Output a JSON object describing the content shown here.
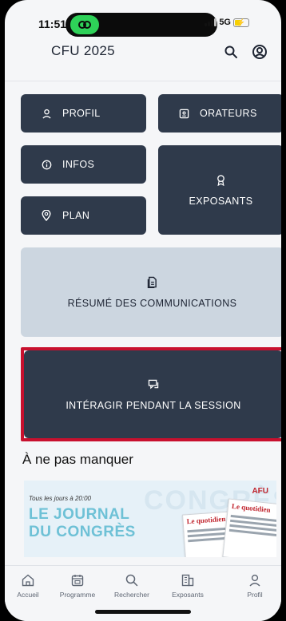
{
  "status_bar": {
    "time": "11:51",
    "network": "5G",
    "battery_level": 0.5
  },
  "header": {
    "title": "CFU 2025",
    "search_icon": "search-icon",
    "profile_icon": "user-circle-icon"
  },
  "tiles": {
    "profil": {
      "label": "PROFIL",
      "icon": "user-icon"
    },
    "orateurs": {
      "label": "ORATEURS",
      "icon": "id-card-icon"
    },
    "infos": {
      "label": "INFOS",
      "icon": "info-icon"
    },
    "exposants": {
      "label": "EXPOSANTS",
      "icon": "badge-icon"
    },
    "plan": {
      "label": "PLAN",
      "icon": "map-pin-icon"
    },
    "resume": {
      "label": "RÉSUMÉ DES COMMUNICATIONS",
      "icon": "document-icon"
    },
    "interagir": {
      "label": "INTÉRAGIR PENDANT LA SESSION",
      "icon": "chat-icon"
    }
  },
  "section": {
    "title": "À ne pas manquer"
  },
  "banner": {
    "subtitle": "Tous les jours à 20:00",
    "title_line1": "LE JOURNAL",
    "title_line2": "DU CONGRÈS",
    "watermark": "CONGRÈS",
    "logo": "AFU",
    "paper_title": "Le quotidien",
    "paper_title2": "Le quotidien"
  },
  "tabbar": {
    "items": [
      {
        "label": "Accueil",
        "icon": "home-icon"
      },
      {
        "label": "Programme",
        "icon": "calendar-icon"
      },
      {
        "label": "Rechercher",
        "icon": "search-icon"
      },
      {
        "label": "Exposants",
        "icon": "building-icon"
      },
      {
        "label": "Profil",
        "icon": "user-icon"
      }
    ]
  },
  "colors": {
    "tile_dark": "#2f3a4b",
    "tile_light": "#ccd6e0",
    "highlight": "#c8102e",
    "banner_title": "#6ec1d6"
  }
}
